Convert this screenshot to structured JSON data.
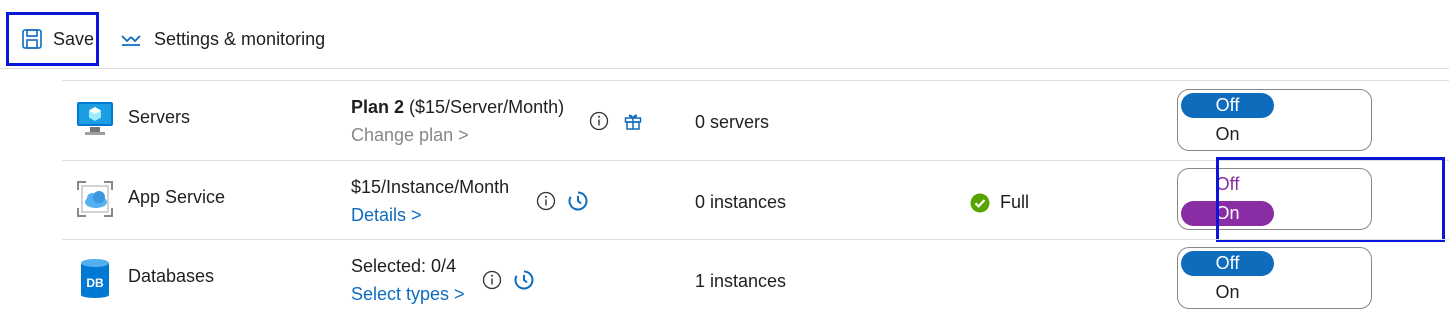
{
  "toolbar": {
    "save_label": "Save",
    "settings_label": "Settings & monitoring"
  },
  "rows": [
    {
      "name": "Servers",
      "price_bold": "Plan 2",
      "price_rest": " ($15/Server/Month)",
      "sub": "Change plan >",
      "count": "0 servers",
      "status": "",
      "toggle_top": "Off",
      "toggle_bottom": "On",
      "selected": "Off"
    },
    {
      "name": "App Service",
      "price": "$15/Instance/Month",
      "sub": "Details >",
      "count": "0 instances",
      "status": "Full",
      "toggle_top": "Off",
      "toggle_bottom": "On",
      "selected": "On"
    },
    {
      "name": "Databases",
      "price": "Selected: 0/4",
      "sub": "Select types >",
      "count": "1 instances",
      "status": "",
      "toggle_top": "Off",
      "toggle_bottom": "On",
      "selected": "Off"
    }
  ],
  "icons": {
    "save": "save-icon",
    "settings": "settings-monitoring-icon",
    "servers": "server-icon",
    "app_service": "app-service-icon",
    "databases": "database-icon",
    "info": "info-icon",
    "gift": "gift-icon",
    "clock": "clock-icon",
    "check": "check-circle-icon"
  },
  "colors": {
    "accent_blue": "#0f6cbd",
    "selected_purple": "#8a2da5",
    "highlight_box": "#0a17d9",
    "success_green": "#57a300"
  }
}
